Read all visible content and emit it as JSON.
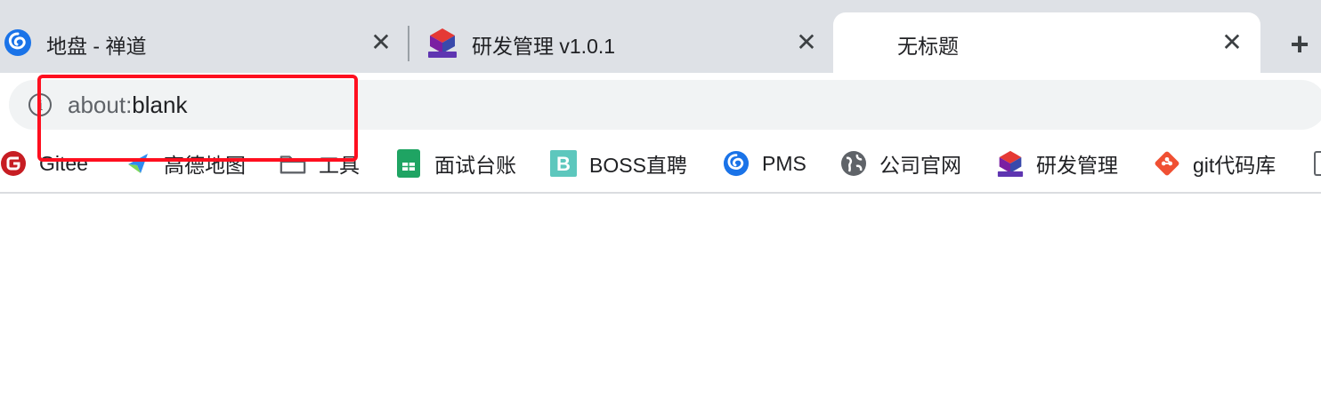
{
  "tabs": [
    {
      "title": "地盘 - 禅道",
      "icon": "zentao-swirl-icon",
      "active": false
    },
    {
      "title": "研发管理 v1.0.1",
      "icon": "rd-management-logo-icon",
      "active": false
    },
    {
      "title": "无标题",
      "icon": "",
      "active": true
    }
  ],
  "tab_close_glyph": "✕",
  "new_tab_glyph": "+",
  "omnibox": {
    "scheme": "about:",
    "rest": "blank",
    "info_glyph": "i"
  },
  "bookmarks": [
    {
      "label": "Gitee",
      "icon": "gitee-icon"
    },
    {
      "label": "高德地图",
      "icon": "amap-icon"
    },
    {
      "label": "工具",
      "icon": "folder-icon"
    },
    {
      "label": "面试台账",
      "icon": "sheets-icon"
    },
    {
      "label": "BOSS直聘",
      "icon": "boss-icon"
    },
    {
      "label": "PMS",
      "icon": "zentao-swirl-icon"
    },
    {
      "label": "公司官网",
      "icon": "globe-icon"
    },
    {
      "label": "研发管理",
      "icon": "rd-management-logo-icon"
    },
    {
      "label": "git代码库",
      "icon": "git-icon"
    }
  ],
  "colors": {
    "tabstrip": "#dee1e6",
    "omnibox": "#f1f3f4",
    "highlight": "#ff0f1f",
    "gitee": "#c71d23",
    "sheets": "#1fa463",
    "boss": "#5dc7bd",
    "git": "#f05033"
  }
}
